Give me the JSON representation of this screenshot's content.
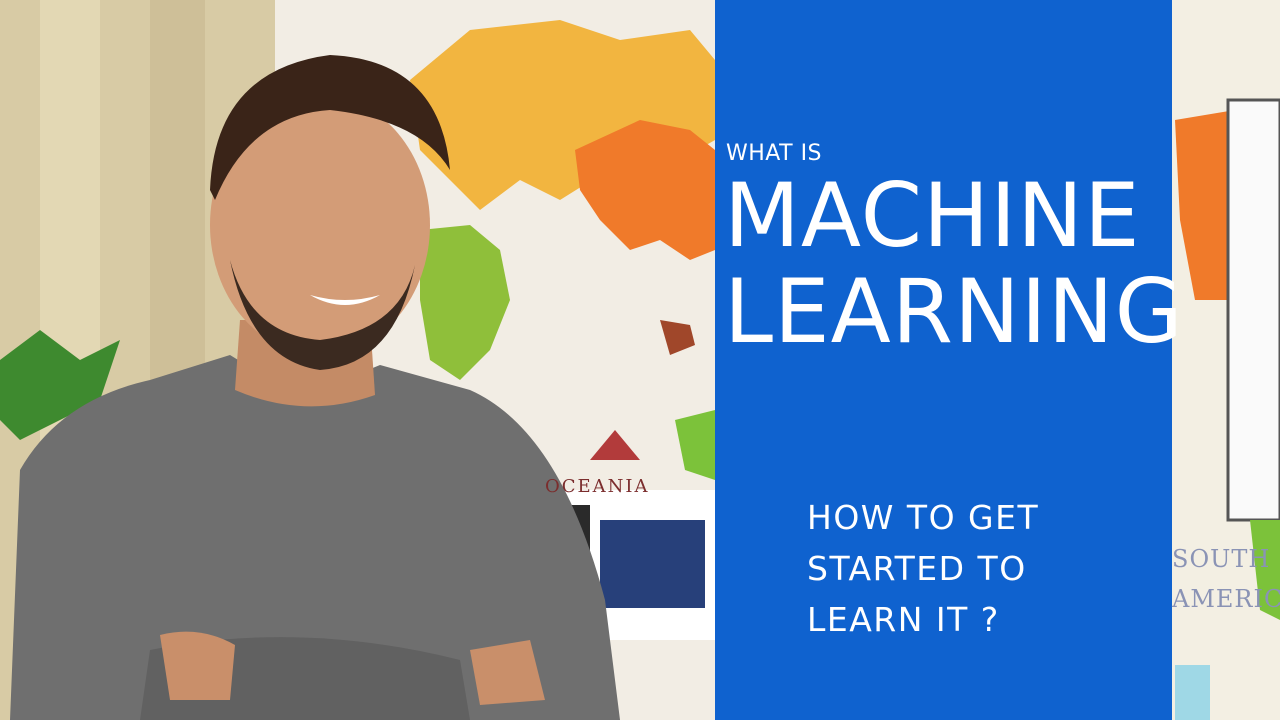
{
  "thumbnail": {
    "kicker": "WHAT IS",
    "title_lines": [
      "MACHINE",
      "LEARNING"
    ],
    "subtitle_lines": [
      "HOW TO GET",
      "STARTED TO",
      "LEARN IT ?"
    ]
  },
  "background_map": {
    "labels": [
      "OCEANIA",
      "SOUTH",
      "AMERICA"
    ]
  },
  "colors": {
    "panel_blue": "#0f62cf",
    "text": "#ffffff",
    "shirt_gray": "#6f6f6f",
    "map_orange": "#f07a2a",
    "map_yellow": "#f2b540",
    "map_green": "#7cc23a"
  }
}
